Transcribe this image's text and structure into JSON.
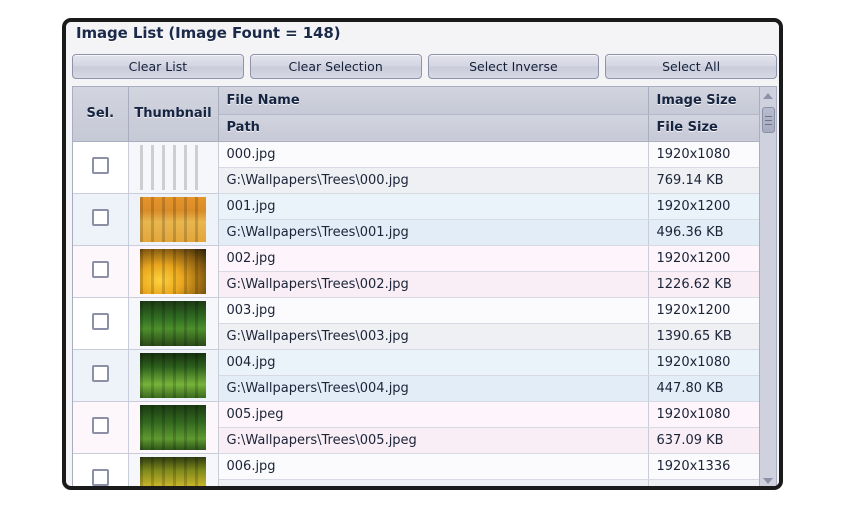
{
  "panel": {
    "title": "Image List (Image Fount = 148)"
  },
  "toolbar": {
    "buttons": [
      {
        "label": "Clear List",
        "name": "clear-list-button"
      },
      {
        "label": "Clear Selection",
        "name": "clear-selection-button"
      },
      {
        "label": "Select Inverse",
        "name": "select-inverse-button"
      },
      {
        "label": "Select All",
        "name": "select-all-button"
      }
    ]
  },
  "grid": {
    "headers": {
      "sel": "Sel.",
      "thumbnail": "Thumbnail",
      "file_name": "File Name",
      "path": "Path",
      "image_size": "Image Size",
      "file_size": "File Size"
    },
    "rows": [
      {
        "checked": false,
        "file_name": "000.jpg",
        "path": "G:\\Wallpapers\\Trees\\000.jpg",
        "image_size": "1920x1080",
        "file_size": "769.14 KB",
        "thumb": "sunlit-tree-meadow"
      },
      {
        "checked": false,
        "file_name": "001.jpg",
        "path": "G:\\Wallpapers\\Trees\\001.jpg",
        "image_size": "1920x1200",
        "file_size": "496.36 KB",
        "thumb": "autumn-tree-field"
      },
      {
        "checked": false,
        "file_name": "002.jpg",
        "path": "G:\\Wallpapers\\Trees\\002.jpg",
        "image_size": "1920x1200",
        "file_size": "1226.62 KB",
        "thumb": "golden-sunset-tree"
      },
      {
        "checked": false,
        "file_name": "003.jpg",
        "path": "G:\\Wallpapers\\Trees\\003.jpg",
        "image_size": "1920x1200",
        "file_size": "1390.65 KB",
        "thumb": "green-tree-road"
      },
      {
        "checked": false,
        "file_name": "004.jpg",
        "path": "G:\\Wallpapers\\Trees\\004.jpg",
        "image_size": "1920x1080",
        "file_size": "447.80 KB",
        "thumb": "green-tree-alley"
      },
      {
        "checked": false,
        "file_name": "005.jpeg",
        "path": "G:\\Wallpapers\\Trees\\005.jpeg",
        "image_size": "1920x1080",
        "file_size": "637.09 KB",
        "thumb": "green-tree-path"
      },
      {
        "checked": false,
        "file_name": "006.jpg",
        "path": "",
        "image_size": "1920x1336",
        "file_size": "",
        "thumb": "golden-tree-avenue"
      }
    ]
  },
  "scrollbar": {
    "up_arrow": "scroll-up",
    "down_arrow": "scroll-down"
  },
  "colors": {
    "frame": "#1a1a1a",
    "header_bg": "#c6c9d6",
    "title_text": "#1b2a4a",
    "row_alt_blue": "#eaf2fa",
    "row_alt_pink": "#fdf5fb"
  }
}
